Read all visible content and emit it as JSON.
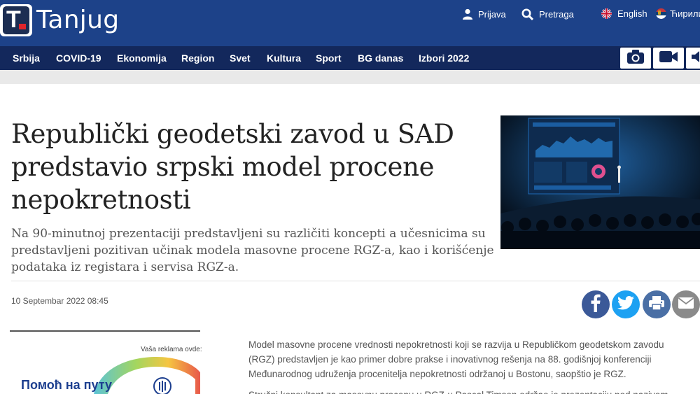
{
  "brand": {
    "name": "Tanjug",
    "logo_letter": "T"
  },
  "top_links": {
    "login": "Prijava",
    "search": "Pretraga",
    "english": "English",
    "cyrillic": "Ћирилица"
  },
  "nav": {
    "items": [
      "Srbija",
      "COVID-19",
      "Ekonomija",
      "Region",
      "Svet",
      "Kultura",
      "Sport",
      "BG danas",
      "Izbori 2022"
    ]
  },
  "article": {
    "title": "Republički geodetski zavod u SAD predstavio srpski model procene nepokretnosti",
    "lead": "Na 90-minutnoj prezentaciji predstavljeni su različiti koncepti a učesnicima su predstavljeni pozitivan učinak modela masovne procene RGZ-a, kao i korišćenje podataka iz registara i servisa RGZ-a.",
    "date": "10 Septembar 2022 08:45",
    "body_p1": "Model masovne procene vrednosti nepokretnosti koji se razvija u Republičkom geodetskom zavodu (RGZ) predstavljen je kao primer dobre prakse i inovativnog rešenja na 88. godišnjoj konferenciji Međunarodnog udruženja procenitelja nepokretnosti održanoj u Bostonu, saopštio je RGZ.",
    "body_p2": "Stručni konsultant za masovnu procenu u RGZ-u Pascal Timson održao je prezentaciju pod nazivom"
  },
  "ad": {
    "label": "Vaša reklama ovde:",
    "text": "Помоћ на путу"
  },
  "colors": {
    "header": "#1d4289",
    "nav": "#13285c",
    "facebook": "#3b5998",
    "twitter": "#1da1f2",
    "print": "#4a6fa5",
    "email": "#8a8a8a"
  }
}
